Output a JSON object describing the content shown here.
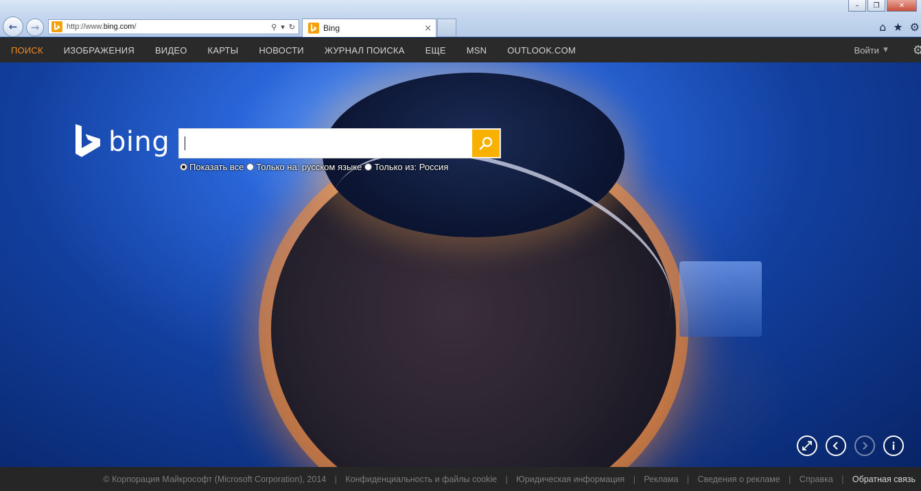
{
  "browser": {
    "address": {
      "scheme": "http://www.",
      "host": "bing.com",
      "path": "/"
    },
    "tab_title": "Bing",
    "tab_close": "×",
    "win_min": "–",
    "win_max": "❐",
    "win_close": "✕"
  },
  "topnav": {
    "items": [
      "ПОИСК",
      "ИЗОБРАЖЕНИЯ",
      "ВИДЕО",
      "КАРТЫ",
      "НОВОСТИ",
      "ЖУРНАЛ ПОИСКА",
      "ЕЩЕ",
      "MSN",
      "OUTLOOK.COM"
    ],
    "active_index": 0,
    "signin": "Войти"
  },
  "logo_text": "bing",
  "search": {
    "value": ""
  },
  "scope": {
    "options": [
      "Показать все",
      "Только на: русском языке",
      "Только из: Россия"
    ],
    "selected_index": 0
  },
  "footer": {
    "items": [
      "© Корпорация Майкрософт (Microsoft Corporation), 2014",
      "Конфиденциальность и файлы cookie",
      "Юридическая информация",
      "Реклама",
      "Сведения о рекламе",
      "Справка",
      "Обратная связь"
    ]
  },
  "colors": {
    "accent": "#f68b1f",
    "search_button": "#f9b100",
    "nav_bg": "#2a2a2a",
    "footer_bg": "#262626"
  }
}
